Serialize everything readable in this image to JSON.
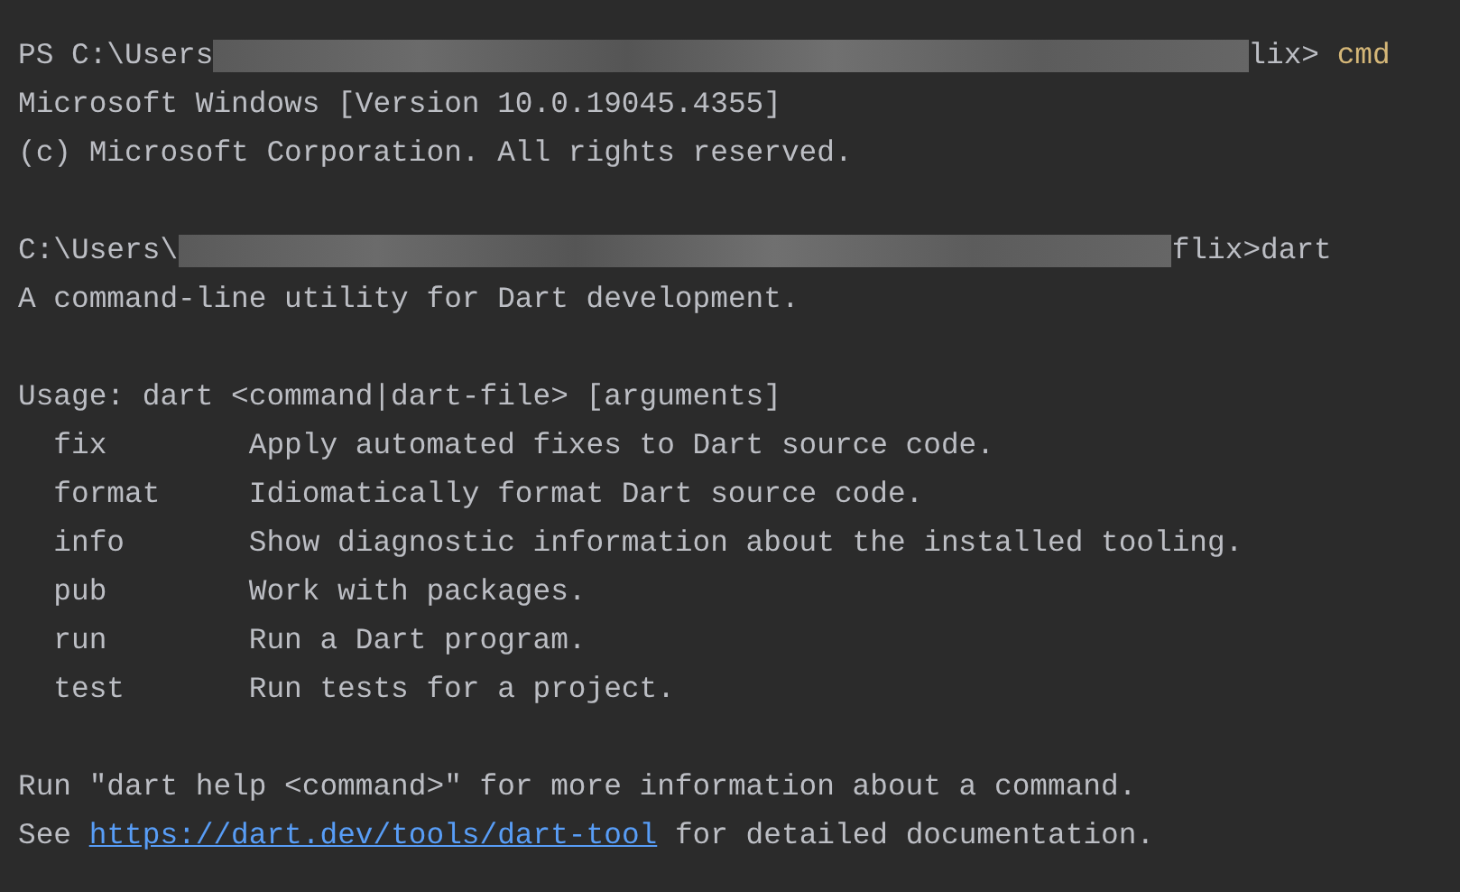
{
  "terminal": {
    "lines": [
      {
        "kind": "prompt",
        "prefix": "PS C:\\Users",
        "suffix": "lix> ",
        "command": "cmd"
      },
      {
        "kind": "text",
        "text": "Microsoft Windows [Version 10.0.19045.4355]"
      },
      {
        "kind": "text",
        "text": "(c) Microsoft Corporation. All rights reserved."
      },
      {
        "kind": "blank"
      },
      {
        "kind": "prompt",
        "prefix": "C:\\Users\\",
        "suffix": "flix>",
        "command": "dart"
      },
      {
        "kind": "text",
        "text": "A command-line utility for Dart development."
      },
      {
        "kind": "blank"
      },
      {
        "kind": "text",
        "text": "Usage: dart <command|dart-file> [arguments]"
      },
      {
        "kind": "help",
        "name": "fix",
        "description": "Apply automated fixes to Dart source code."
      },
      {
        "kind": "help",
        "name": "format",
        "description": "Idiomatically format Dart source code."
      },
      {
        "kind": "help",
        "name": "info",
        "description": "Show diagnostic information about the installed tooling."
      },
      {
        "kind": "help",
        "name": "pub",
        "description": "Work with packages."
      },
      {
        "kind": "help",
        "name": "run",
        "description": "Run a Dart program."
      },
      {
        "kind": "help",
        "name": "test",
        "description": "Run tests for a project."
      },
      {
        "kind": "blank"
      },
      {
        "kind": "text",
        "text": "Run \"dart help <command>\" for more information about a command."
      },
      {
        "kind": "link",
        "before": "See ",
        "link": "https://dart.dev/tools/dart-tool",
        "after": " for detailed documentation."
      }
    ]
  }
}
